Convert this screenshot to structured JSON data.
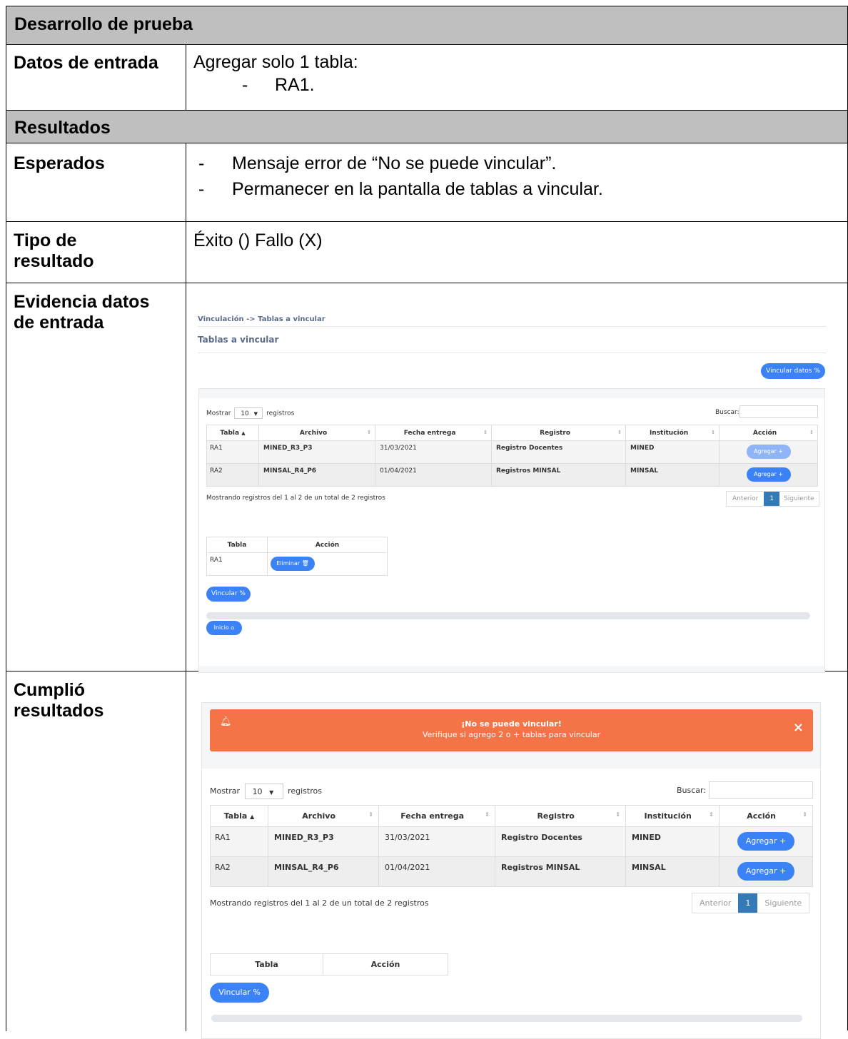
{
  "header": {
    "title": "Desarrollo de prueba"
  },
  "entrada": {
    "label": "Datos de entrada",
    "line1": "Agregar solo 1 tabla:",
    "bullet": "-",
    "item": "RA1."
  },
  "resultados": {
    "title": "Resultados"
  },
  "esperados": {
    "label": "Esperados",
    "items": [
      "Mensaje error de “No se puede vincular”.",
      "Permanecer en la pantalla de tablas a vincular."
    ],
    "bullet": "-"
  },
  "tipo": {
    "label_l1": "Tipo de",
    "label_l2": "resultado",
    "value": "Éxito () Fallo (X)"
  },
  "evidencia": {
    "label_l1": "Evidencia datos",
    "label_l2": "de entrada",
    "breadcrumb": "Vinculación -> Tablas a vincular",
    "page_title": "Tablas a vincular",
    "vincular_datos": "Vincular datos %",
    "mostrar": "Mostrar",
    "page_size": "10",
    "registros": "registros",
    "buscar": "Buscar:",
    "columns": [
      "Tabla",
      "Archivo",
      "Fecha entrega",
      "Registro",
      "Institución",
      "Acción"
    ],
    "rows": [
      {
        "tabla": "RA1",
        "archivo": "MINED_R3_P3",
        "fecha": "31/03/2021",
        "registro": "Registro Docentes",
        "inst": "MINED",
        "accion": "Agregar +"
      },
      {
        "tabla": "RA2",
        "archivo": "MINSAL_R4_P6",
        "fecha": "01/04/2021",
        "registro": "Registros MINSAL",
        "inst": "MINSAL",
        "accion": "Agregar +"
      }
    ],
    "info": "Mostrando registros del 1 al 2 de un total de 2 registros",
    "anterior": "Anterior",
    "page": "1",
    "siguiente": "Siguiente",
    "sel_cols": [
      "Tabla",
      "Acción"
    ],
    "sel_row": {
      "tabla": "RA1",
      "accion": "Eliminar 🗑"
    },
    "vincular": "Vincular %",
    "inicio": "Inicio ⌂"
  },
  "cumplio": {
    "label_l1": "Cumplió",
    "label_l2": "resultados",
    "alert_title": "¡No se puede vincular!",
    "alert_text": "Verifique si agrego 2 o + tablas para vincular",
    "alert_color": "#f47448",
    "bell_icon": "bell-icon",
    "close": "×",
    "mostrar": "Mostrar",
    "page_size": "10",
    "registros": "registros",
    "buscar": "Buscar:",
    "columns": [
      "Tabla",
      "Archivo",
      "Fecha entrega",
      "Registro",
      "Institución",
      "Acción"
    ],
    "rows": [
      {
        "tabla": "RA1",
        "archivo": "MINED_R3_P3",
        "fecha": "31/03/2021",
        "registro": "Registro Docentes",
        "inst": "MINED",
        "accion": "Agregar +"
      },
      {
        "tabla": "RA2",
        "archivo": "MINSAL_R4_P6",
        "fecha": "01/04/2021",
        "registro": "Registros MINSAL",
        "inst": "MINSAL",
        "accion": "Agregar +"
      }
    ],
    "info": "Mostrando registros del 1 al 2 de un total de 2 registros",
    "anterior": "Anterior",
    "page": "1",
    "siguiente": "Siguiente",
    "sel_cols": [
      "Tabla",
      "Acción"
    ],
    "vincular": "Vincular %"
  }
}
